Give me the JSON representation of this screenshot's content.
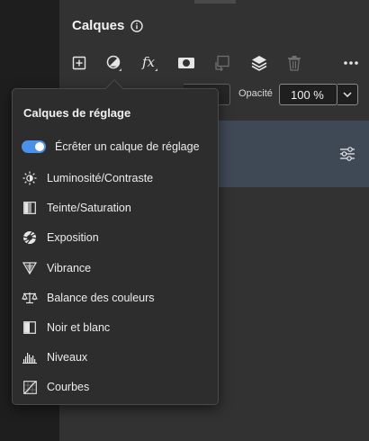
{
  "panel": {
    "title": "Calques",
    "opacity_label": "Opacité",
    "opacity_value": "100 %"
  },
  "toolbar": {
    "icons": [
      "add-layer-icon",
      "adjustment-layer-icon",
      "fx-icon",
      "mask-icon",
      "clip-icon",
      "layers-stack-icon",
      "trash-icon",
      "more-icon"
    ]
  },
  "menu": {
    "heading": "Calques de réglage",
    "toggle_label": "Écrêter un calque de réglage",
    "toggle_on": true,
    "items": [
      {
        "label": "Luminosité/Contraste",
        "icon": "brightness-icon"
      },
      {
        "label": "Teinte/Saturation",
        "icon": "hue-saturation-icon"
      },
      {
        "label": "Exposition",
        "icon": "exposure-icon"
      },
      {
        "label": "Vibrance",
        "icon": "vibrance-icon"
      },
      {
        "label": "Balance des couleurs",
        "icon": "color-balance-icon"
      },
      {
        "label": "Noir et blanc",
        "icon": "black-white-icon"
      },
      {
        "label": "Niveaux",
        "icon": "levels-icon"
      },
      {
        "label": "Courbes",
        "icon": "curves-icon"
      }
    ]
  },
  "colors": {
    "accent": "#4b91e8",
    "panel_bg": "#323232",
    "menu_bg": "#2d2d2d",
    "selected_layer": "#3f4855"
  }
}
